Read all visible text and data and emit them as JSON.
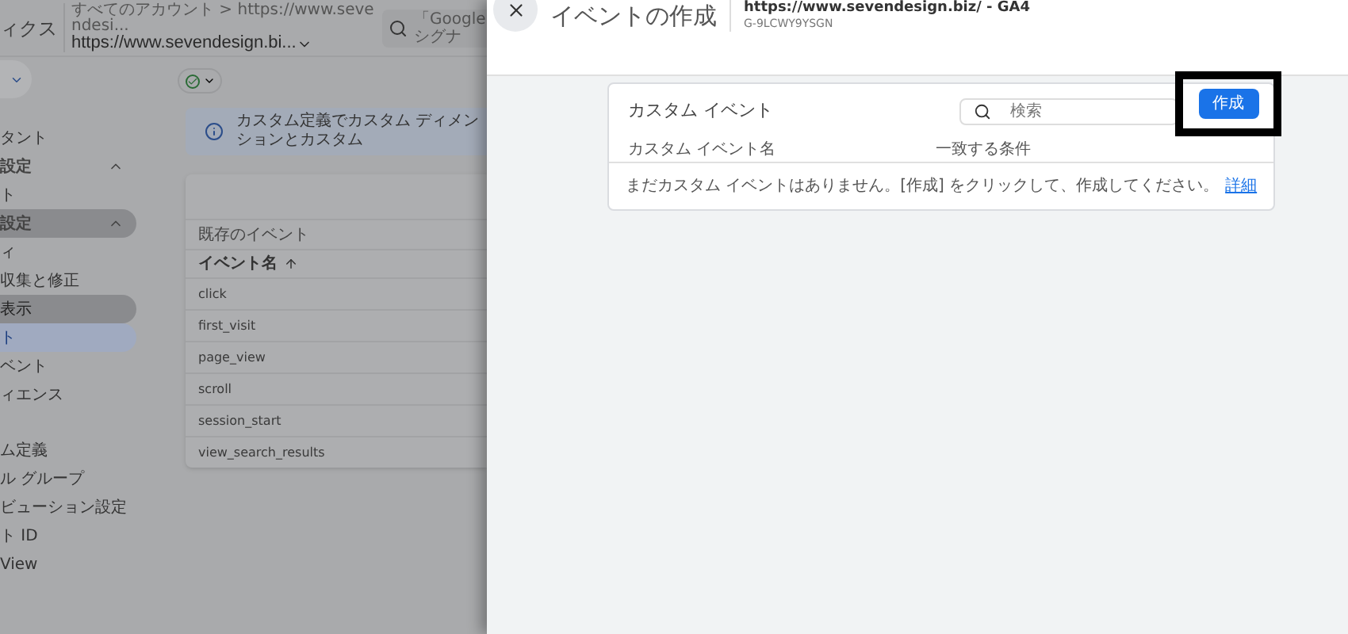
{
  "background": {
    "header": {
      "app_title": "ィクス",
      "breadcrumb": "すべてのアカウント > https://www.sevendesi...",
      "property": "https://www.sevendesign.bi...",
      "search_placeholder": "「Google シグナ"
    },
    "sidebar": {
      "items": [
        {
          "label": "タント",
          "kind": "item",
          "selected": false,
          "highlighted": false
        },
        {
          "label": "設定",
          "kind": "section",
          "expanded": true,
          "selected": false,
          "highlighted": false
        },
        {
          "label": "ト",
          "kind": "item",
          "selected": false,
          "highlighted": false
        },
        {
          "label": "設定",
          "kind": "section",
          "expanded": true,
          "selected": false,
          "highlighted": true
        },
        {
          "label": "ィ",
          "kind": "item",
          "selected": false,
          "highlighted": false
        },
        {
          "label": "収集と修正",
          "kind": "item",
          "selected": false,
          "highlighted": false
        },
        {
          "label": "表示",
          "kind": "item",
          "selected": false,
          "highlighted": true
        },
        {
          "label": "ト",
          "kind": "item",
          "selected": true,
          "highlighted": false
        },
        {
          "label": "ベント",
          "kind": "item",
          "selected": false,
          "highlighted": false
        },
        {
          "label": "ィエンス",
          "kind": "item",
          "selected": false,
          "highlighted": false
        },
        {
          "kind": "spacer"
        },
        {
          "label": "ム定義",
          "kind": "item",
          "selected": false,
          "highlighted": false
        },
        {
          "label": "ル グループ",
          "kind": "item",
          "selected": false,
          "highlighted": false
        },
        {
          "label": "ビューション設定",
          "kind": "item",
          "selected": false,
          "highlighted": false
        },
        {
          "label": "ト ID",
          "kind": "item",
          "selected": false,
          "highlighted": false
        },
        {
          "label": "View",
          "kind": "item",
          "selected": false,
          "highlighted": false
        }
      ]
    },
    "info_banner": "カスタム定義でカスタム ディメンションとカスタム",
    "events_card": {
      "title": "既存のイベント",
      "column": "イベント名",
      "rows": [
        "click",
        "first_visit",
        "page_view",
        "scroll",
        "session_start",
        "view_search_results"
      ]
    }
  },
  "drawer": {
    "title": "イベントの作成",
    "property_url": "https://www.sevendesign.biz/ - GA4",
    "property_id": "G-9LCWY9YSGN",
    "card": {
      "title": "カスタム イベント",
      "search_placeholder": "検索",
      "create_button": "作成",
      "columns": [
        "カスタム イベント名",
        "一致する条件"
      ],
      "empty_message": "まだカスタム イベントはありません。[作成] をクリックして、作成してください。",
      "link": "詳細"
    }
  }
}
